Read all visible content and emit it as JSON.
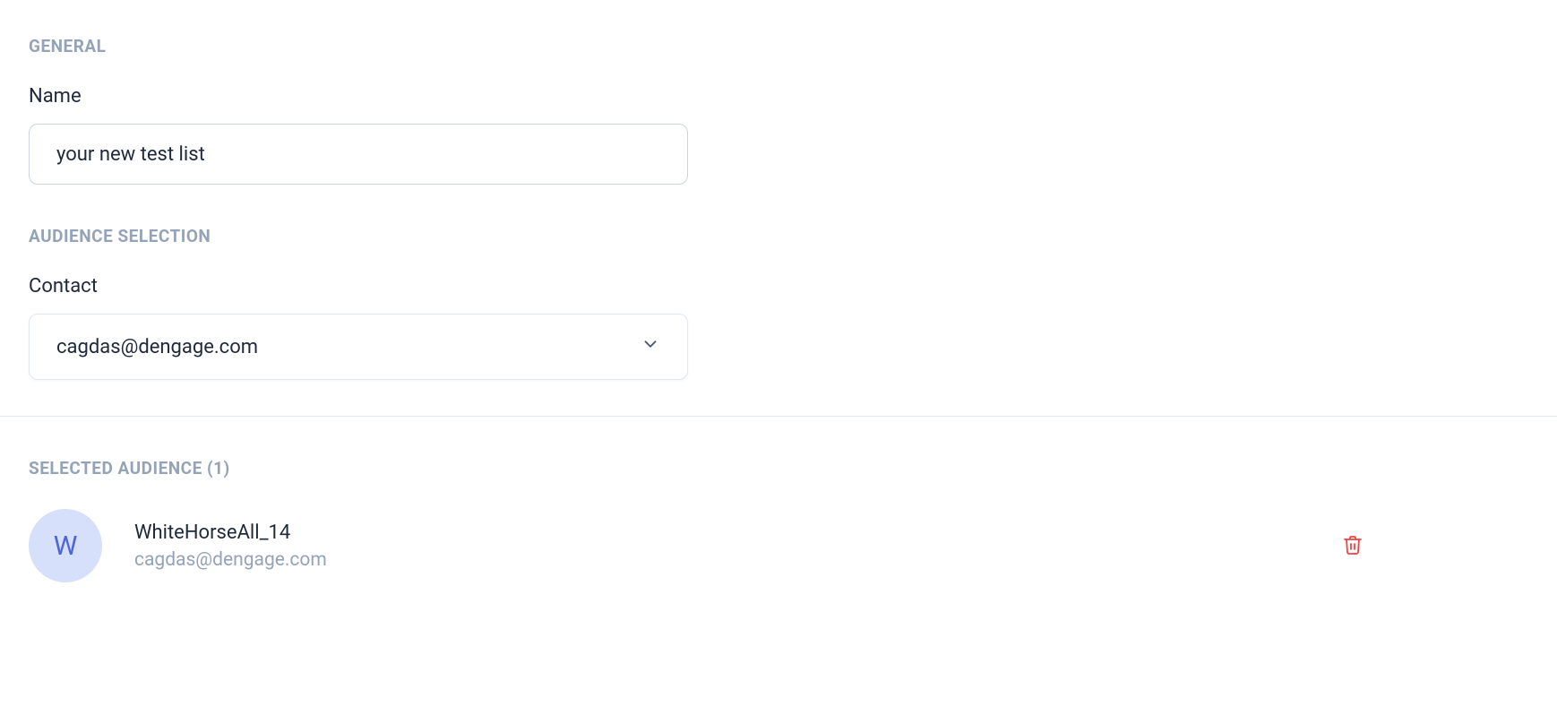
{
  "general": {
    "header": "GENERAL",
    "name_label": "Name",
    "name_value": "your new test list"
  },
  "audience_selection": {
    "header": "AUDIENCE SELECTION",
    "contact_label": "Contact",
    "contact_value": "cagdas@dengage.com"
  },
  "selected_audience": {
    "header": "SELECTED AUDIENCE (1)",
    "items": [
      {
        "avatar_letter": "W",
        "name": "WhiteHorseAll_14",
        "email": "cagdas@dengage.com"
      }
    ]
  }
}
